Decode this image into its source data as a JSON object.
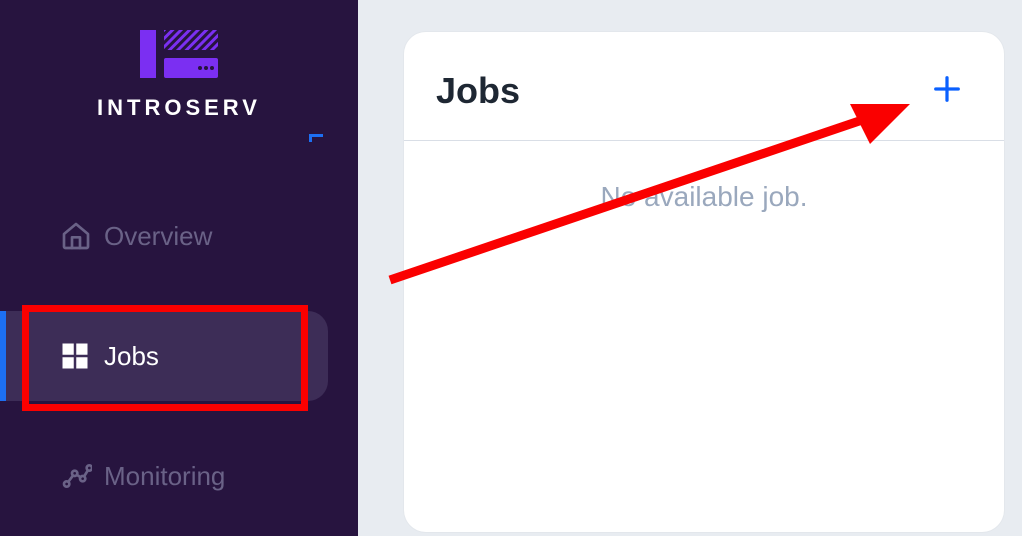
{
  "brand": {
    "name": "INTROSERV"
  },
  "sidebar": {
    "items": [
      {
        "label": "Overview"
      },
      {
        "label": "Jobs"
      },
      {
        "label": "Monitoring"
      }
    ],
    "activeIndex": 1
  },
  "main": {
    "card": {
      "title": "Jobs",
      "empty_message": "No available job."
    }
  },
  "annotations": {
    "highlight_target": "sidebar-item-jobs",
    "arrow_target": "add-job-button"
  },
  "colors": {
    "sidebar_bg": "#27143f",
    "accent": "#1d6ff2",
    "brand_purple": "#7b2ff2",
    "annotation_red": "#fa0000"
  }
}
